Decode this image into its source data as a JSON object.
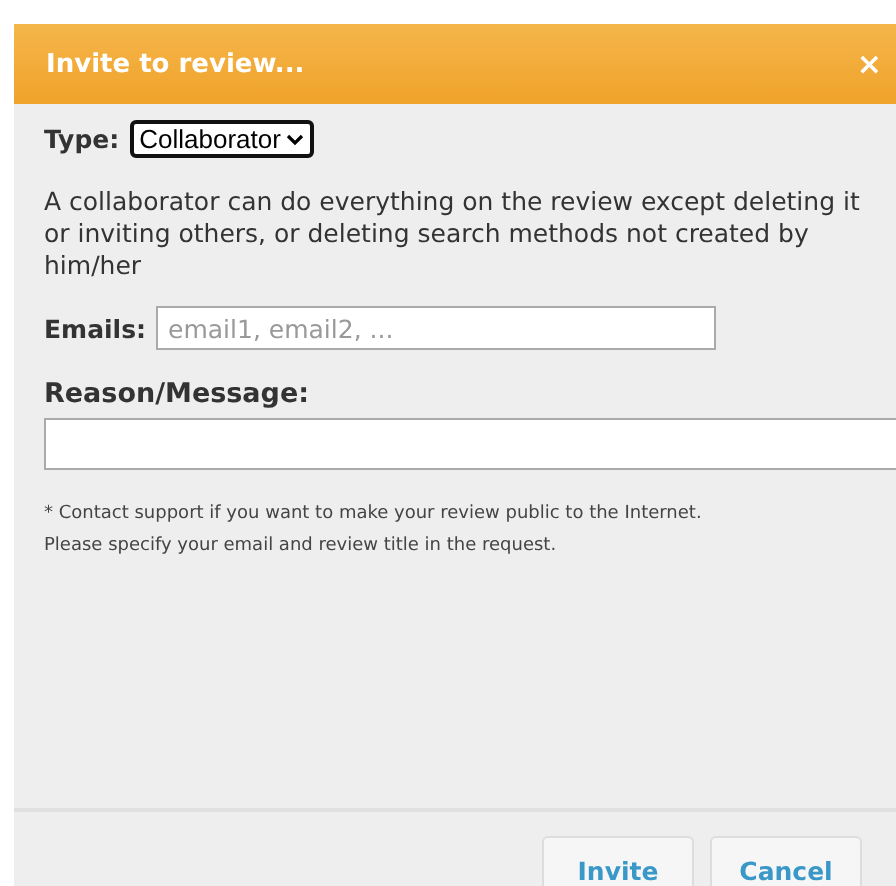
{
  "dialog": {
    "title": "Invite to review...",
    "close": "×"
  },
  "type_field": {
    "label": "Type:",
    "value": "Collaborator"
  },
  "description": "A collaborator can do everything on the review except deleting it or inviting others, or deleting search methods not created by him/her",
  "emails_field": {
    "label": "Emails:",
    "placeholder": "email1, email2, ..."
  },
  "reason_field": {
    "label": "Reason/Message:"
  },
  "notes": [
    "* Contact support if you want to make your review public to the Internet.",
    "Please specify your email and review title in the request."
  ],
  "buttons": [
    "Invite",
    "Cancel"
  ]
}
